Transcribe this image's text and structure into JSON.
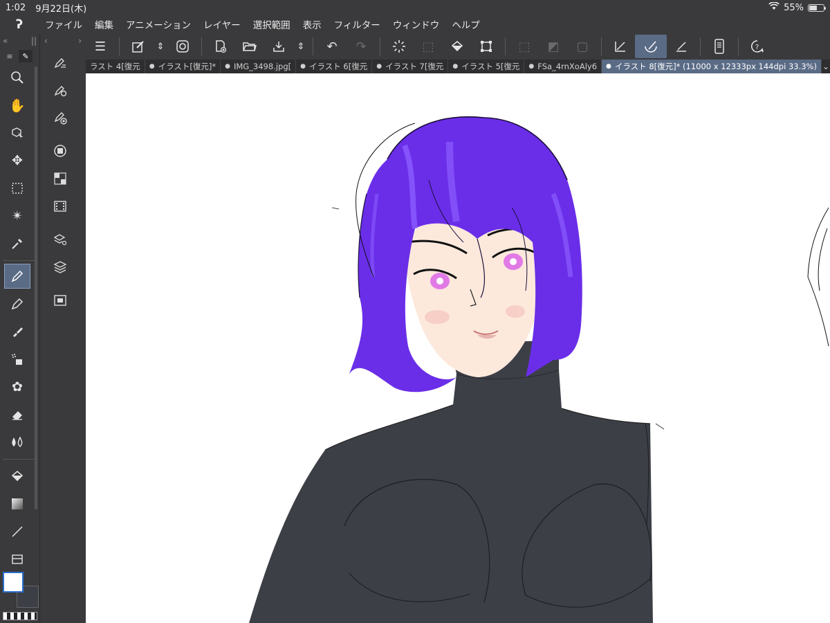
{
  "status": {
    "time": "1:02",
    "date": "9月22日(木)",
    "battery": "55%",
    "battery_level": 0.55,
    "wifi_icon": "wifi-icon"
  },
  "menu": {
    "logo_icon": "clip-studio-logo-icon",
    "items": [
      "ファイル",
      "編集",
      "アニメーション",
      "レイヤー",
      "選択範囲",
      "表示",
      "フィルター",
      "ウィンドウ",
      "ヘルプ"
    ]
  },
  "panel1": {
    "collapse_left": "«",
    "handle": "||",
    "collapse_right": "«"
  },
  "panel2": {
    "expand_left": "‹",
    "expand_right": "›"
  },
  "doc_tabs": [
    {
      "label": "ラスト 4[復元"
    },
    {
      "label": "イラスト[復元]*"
    },
    {
      "label": "IMG_3498.jpg["
    },
    {
      "label": "イラスト 6[復元"
    },
    {
      "label": "イラスト 7[復元"
    },
    {
      "label": "イラスト 5[復元"
    },
    {
      "label": "FSa_4rnXoAly6"
    },
    {
      "label": "イラスト 8[復元]* (11000 x 12333px 144dpi 33.3%)"
    }
  ],
  "doc_tabs_more": "⌄",
  "colors": {
    "foreground": "#ffffff",
    "background": "#3d3f47",
    "accent": "#5a6b86",
    "hair": "#6a2ee8",
    "skin": "#fce9dc",
    "eyes": "#e27ae6",
    "bodysuit": "#3d3f47"
  }
}
